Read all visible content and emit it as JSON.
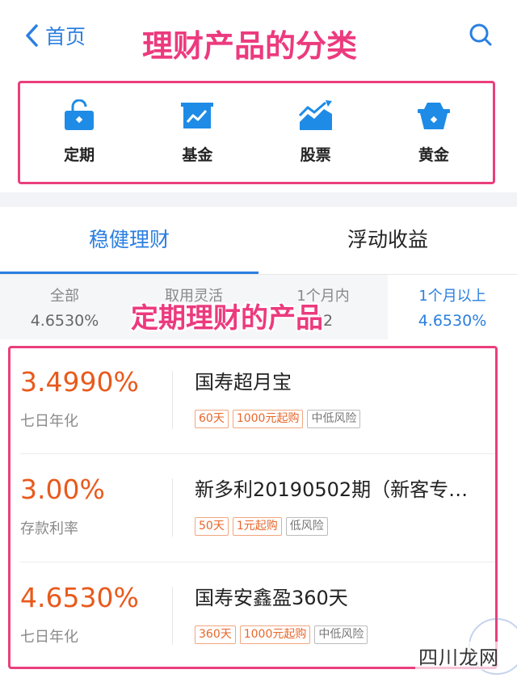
{
  "header": {
    "back_label": "首页",
    "overlay_title": "理财产品的分类"
  },
  "categories": [
    {
      "label": "定期",
      "icon": "lock-bag-icon"
    },
    {
      "label": "基金",
      "icon": "chart-board-icon"
    },
    {
      "label": "股票",
      "icon": "stock-trend-icon"
    },
    {
      "label": "黄金",
      "icon": "gold-basket-icon"
    }
  ],
  "tabs": [
    {
      "label": "稳健理财",
      "active": true
    },
    {
      "label": "浮动收益",
      "active": false
    }
  ],
  "filters": [
    {
      "name": "全部",
      "rate": "4.6530%"
    },
    {
      "name": "取用灵活",
      "rate": ""
    },
    {
      "name": "1个月内",
      "rate": "92"
    },
    {
      "name": "1个月以上",
      "rate": "4.6530%"
    }
  ],
  "overlay_2": "定期理财的产品",
  "products": [
    {
      "rate": "3.4990%",
      "rate_type": "七日年化",
      "name": "国寿超月宝",
      "tags": [
        {
          "text": "60天",
          "style": "orange"
        },
        {
          "text": "1000元起购",
          "style": "orange"
        },
        {
          "text": "中低风险",
          "style": "gray"
        }
      ]
    },
    {
      "rate": "3.00%",
      "rate_type": "存款利率",
      "name": "新多利20190502期（新客专…",
      "tags": [
        {
          "text": "50天",
          "style": "orange"
        },
        {
          "text": "1元起购",
          "style": "orange"
        },
        {
          "text": "低风险",
          "style": "gray"
        }
      ]
    },
    {
      "rate": "4.6530%",
      "rate_type": "七日年化",
      "name": "国寿安鑫盈360天",
      "tags": [
        {
          "text": "360天",
          "style": "orange"
        },
        {
          "text": "1000元起购",
          "style": "orange"
        },
        {
          "text": "中低风险",
          "style": "gray"
        }
      ]
    }
  ],
  "watermark": "四川龙网",
  "colors": {
    "accent": "#2a7fe0",
    "rate": "#e85a1c",
    "highlight": "#ea3f7c"
  }
}
